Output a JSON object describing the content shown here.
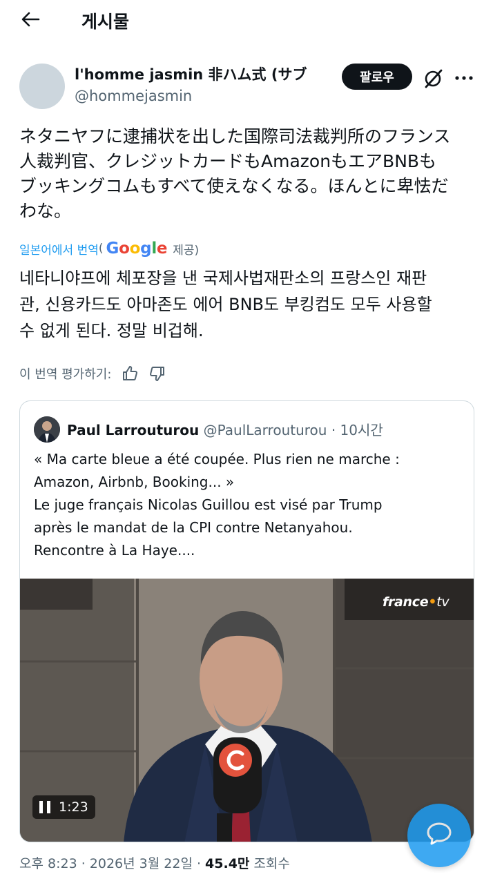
{
  "header": {
    "title": "게시물"
  },
  "author": {
    "display_name": "l'homme jasmin 非ハム式 (サブ",
    "handle": "@hommejasmin",
    "follow_label": "팔로우"
  },
  "post": {
    "lines": [
      "ネタニヤフに逮捕状を出した国際司法裁判所のフランス",
      "人裁判官、クレジットカードもAmazonもエアBNBも",
      "ブッキングコムもすべて使えなくなる。ほんとに卑怯だ",
      "わな。"
    ]
  },
  "translation": {
    "label": "일본어에서 번역",
    "paren_open": "(",
    "google": [
      "G",
      "o",
      "o",
      "g",
      "l",
      "e"
    ],
    "provided": "제공)",
    "lines": [
      "네타니야프에 체포장을 낸 국제사법재판소의 프랑스인 재판",
      "관, 신용카드도 아마존도 에어 BNB도 부킹컴도 모두 사용할",
      "수 없게 된다. 정말 비겁해."
    ],
    "rate_label": "이 번역 평가하기:"
  },
  "quote": {
    "name": "Paul Larrouturou",
    "handle": "@PaulLarrouturou",
    "time": "· 10시간",
    "lines": [
      "« Ma carte bleue a été coupée. Plus rien ne marche :",
      "Amazon, Airbnb, Booking... »",
      "Le juge français Nicolas Guillou est visé par Trump",
      "après le mandat de la CPI contre Netanyahou.",
      "Rencontre à La Haye...."
    ],
    "video": {
      "brand": "france",
      "brand_dot": "•",
      "brand_tv": "tv",
      "duration": "1:23"
    }
  },
  "meta": {
    "time": "오후 8:23 · 2026년 3월 22일 · ",
    "views": "45.4만",
    "views_label": " 조회수"
  },
  "colors": {
    "accent": "#1d9bf0",
    "text": "#0f1419",
    "secondary": "#536471"
  }
}
